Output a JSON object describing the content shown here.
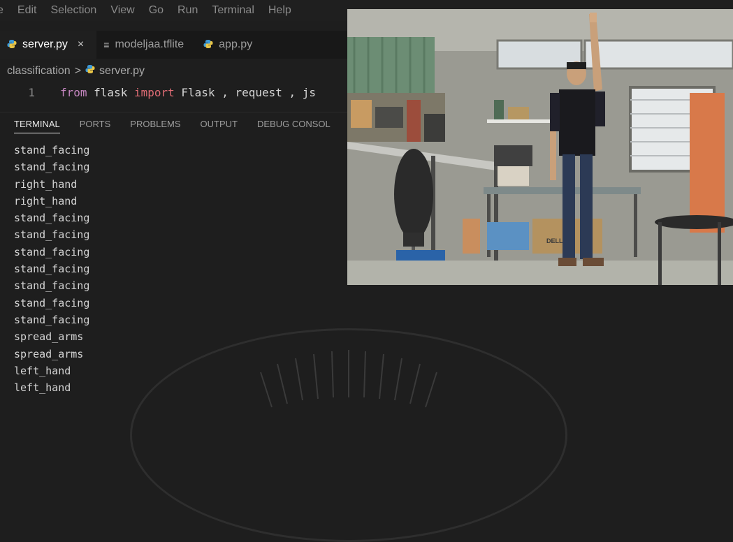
{
  "menubar": {
    "items": [
      "e",
      "Edit",
      "Selection",
      "View",
      "Go",
      "Run",
      "Terminal",
      "Help"
    ]
  },
  "tabs": [
    {
      "label": "server.py",
      "icon": "python-file-icon",
      "active": true,
      "close": "×"
    },
    {
      "label": "modeljaa.tflite",
      "icon": "text-file-icon",
      "active": false
    },
    {
      "label": "app.py",
      "icon": "python-file-icon",
      "active": false
    }
  ],
  "breadcrumb": {
    "folder": "classification",
    "separator": ">",
    "file": "server.py"
  },
  "editor": {
    "line_number": "1",
    "tokens": {
      "from": "from",
      "module": " flask ",
      "import": "import",
      "rest": " Flask , request , js"
    }
  },
  "panel": {
    "tabs": [
      "TERMINAL",
      "PORTS",
      "PROBLEMS",
      "OUTPUT",
      "DEBUG CONSOL"
    ]
  },
  "terminal": {
    "lines": [
      "stand_facing",
      "stand_facing",
      "right_hand",
      "right_hand",
      "stand_facing",
      "stand_facing",
      "stand_facing",
      "stand_facing",
      "stand_facing",
      "stand_facing",
      "stand_facing",
      "spread_arms",
      "spread_arms",
      "left_hand",
      "left_hand"
    ]
  },
  "video": {
    "box_label": "DELL"
  },
  "colors": {
    "background": "#1e1e1e",
    "python_icon": "#3d9bd9",
    "keyword": "#c586c0"
  }
}
